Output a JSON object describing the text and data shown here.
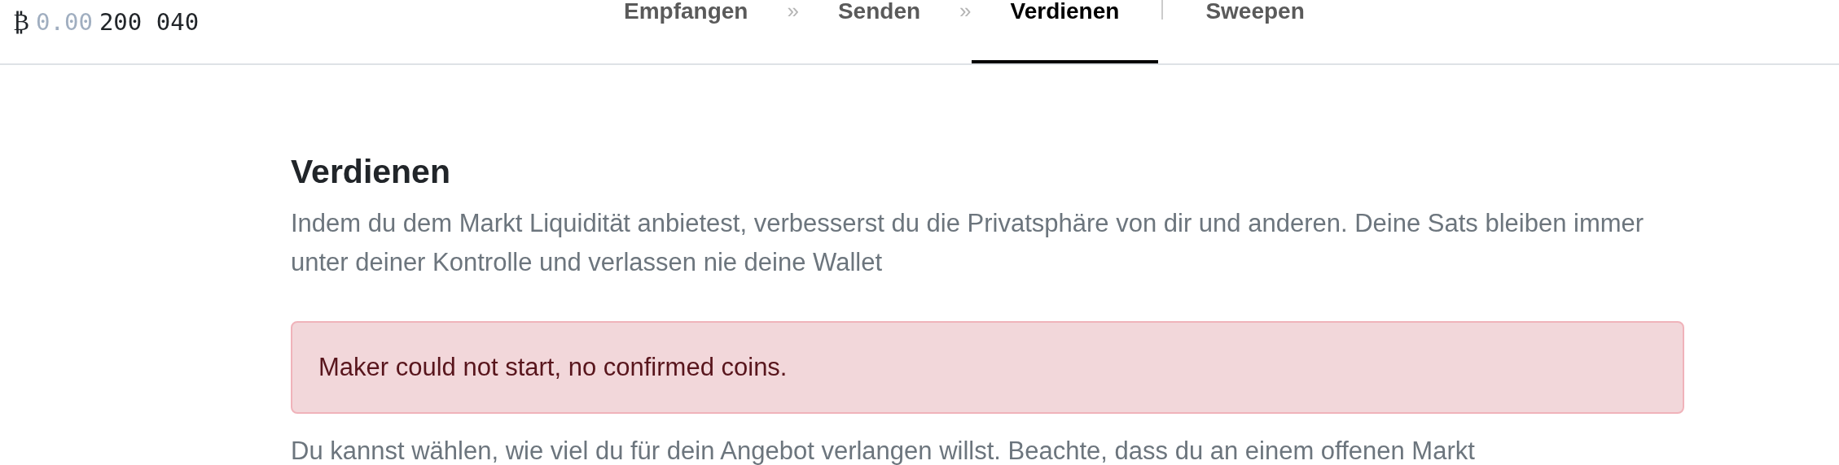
{
  "balance": {
    "symbol": "₿",
    "dim": "0.00",
    "amount": "200 040"
  },
  "nav": [
    {
      "kind": "tab",
      "label": "Empfangen",
      "selected": false
    },
    {
      "kind": "separator",
      "label": "»"
    },
    {
      "kind": "tab",
      "label": "Senden",
      "selected": false
    },
    {
      "kind": "separator",
      "label": "»"
    },
    {
      "kind": "tab",
      "label": "Verdienen",
      "selected": true
    },
    {
      "kind": "divider"
    },
    {
      "kind": "tab",
      "label": "Sweepen",
      "selected": false
    }
  ],
  "heading": "Verdienen",
  "intro": "Indem du dem Markt Liquidität anbietest, verbesserst du die Privatsphäre von dir und anderen. Deine Sats bleiben immer unter deiner Kontrolle und verlassen nie deine Wallet",
  "alert": "Maker could not start, no confirmed coins.",
  "hint": "Du kannst wählen, wie viel du für dein Angebot verlangen willst. Beachte, dass du an einem offenen Markt"
}
